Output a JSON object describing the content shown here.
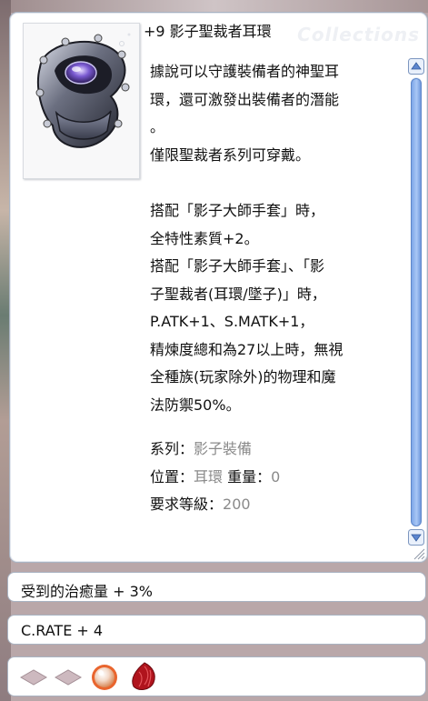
{
  "item": {
    "title": "+9 影子聖裁者耳環",
    "watermark": "Collections",
    "icon": "shadow-earring-icon"
  },
  "description": {
    "paragraph1": [
      "據說可以守護裝備者的神聖耳",
      "環，還可激發出裝備者的潛能",
      "。",
      "僅限聖裁者系列可穿戴。"
    ],
    "paragraph2": [
      "搭配「影子大師手套」時，",
      "全特性素質+2。",
      "搭配「影子大師手套」、「影",
      "子聖裁者(耳環/墜子)」時，",
      "P.ATK+1、S.MATK+1，",
      "精煉度總和為27以上時，無視",
      "全種族(玩家除外)的物理和魔",
      "法防禦50%。"
    ],
    "stats": {
      "type_label": "系列：",
      "type_value": "影子裝備",
      "position_label": "位置：",
      "position_value": "耳環",
      "weight_label": "重量：",
      "weight_value": "0",
      "level_label": "要求等級：",
      "level_value": "200"
    }
  },
  "options": [
    "受到的治癒量 + 3%",
    "C.RATE + 4"
  ],
  "card_slots": [
    "empty-slot-icon",
    "empty-slot-icon",
    "pearl-card-icon",
    "red-gem-card-icon"
  ],
  "colors": {
    "value_gray": "#8a8a8a",
    "window_border": "#a9b3c2",
    "scroll_blue": "#7da6e8"
  }
}
